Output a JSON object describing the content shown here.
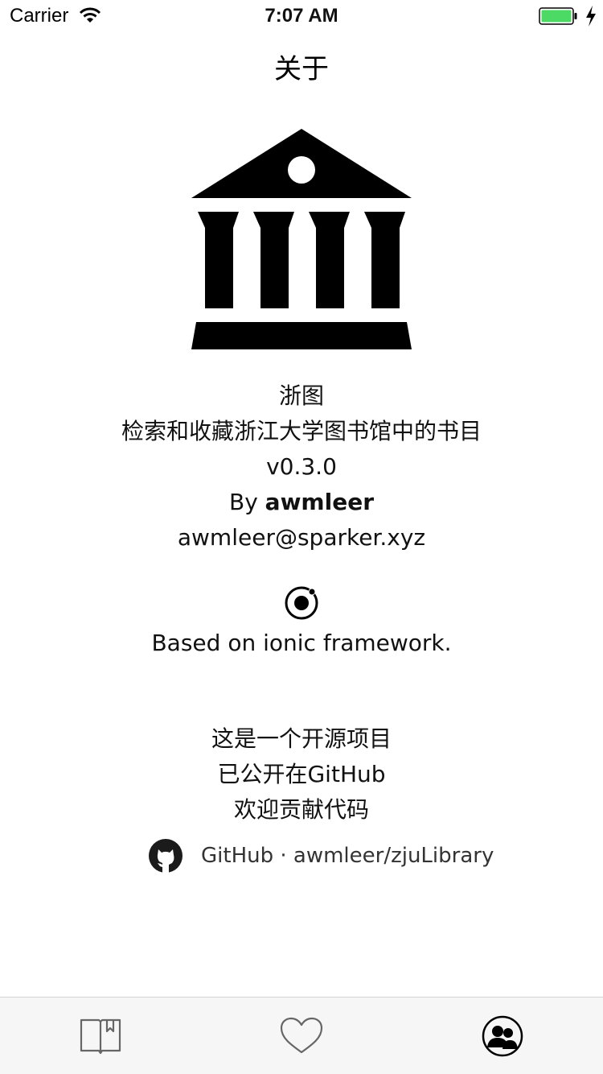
{
  "status_bar": {
    "carrier": "Carrier",
    "time": "7:07 AM",
    "battery_color": "#4cd964"
  },
  "header": {
    "title": "关于"
  },
  "about": {
    "app_name": "浙图",
    "description": "检索和收藏浙江大学图书馆中的书目",
    "version": "v0.3.0",
    "by_prefix": "By",
    "author": "awmleer",
    "email": "awmleer@sparker.xyz"
  },
  "framework": {
    "icon": "ionic-icon",
    "text": "Based on ionic framework."
  },
  "open_source": {
    "lines": [
      "这是一个开源项目",
      "已公开在GitHub",
      "欢迎贡献代码"
    ],
    "link_icon": "github-icon",
    "link_text": "GitHub · awmleer/zjuLibrary"
  },
  "tabs": [
    {
      "icon": "book-icon",
      "active": false
    },
    {
      "icon": "heart-icon",
      "active": false
    },
    {
      "icon": "people-icon",
      "active": true
    }
  ]
}
